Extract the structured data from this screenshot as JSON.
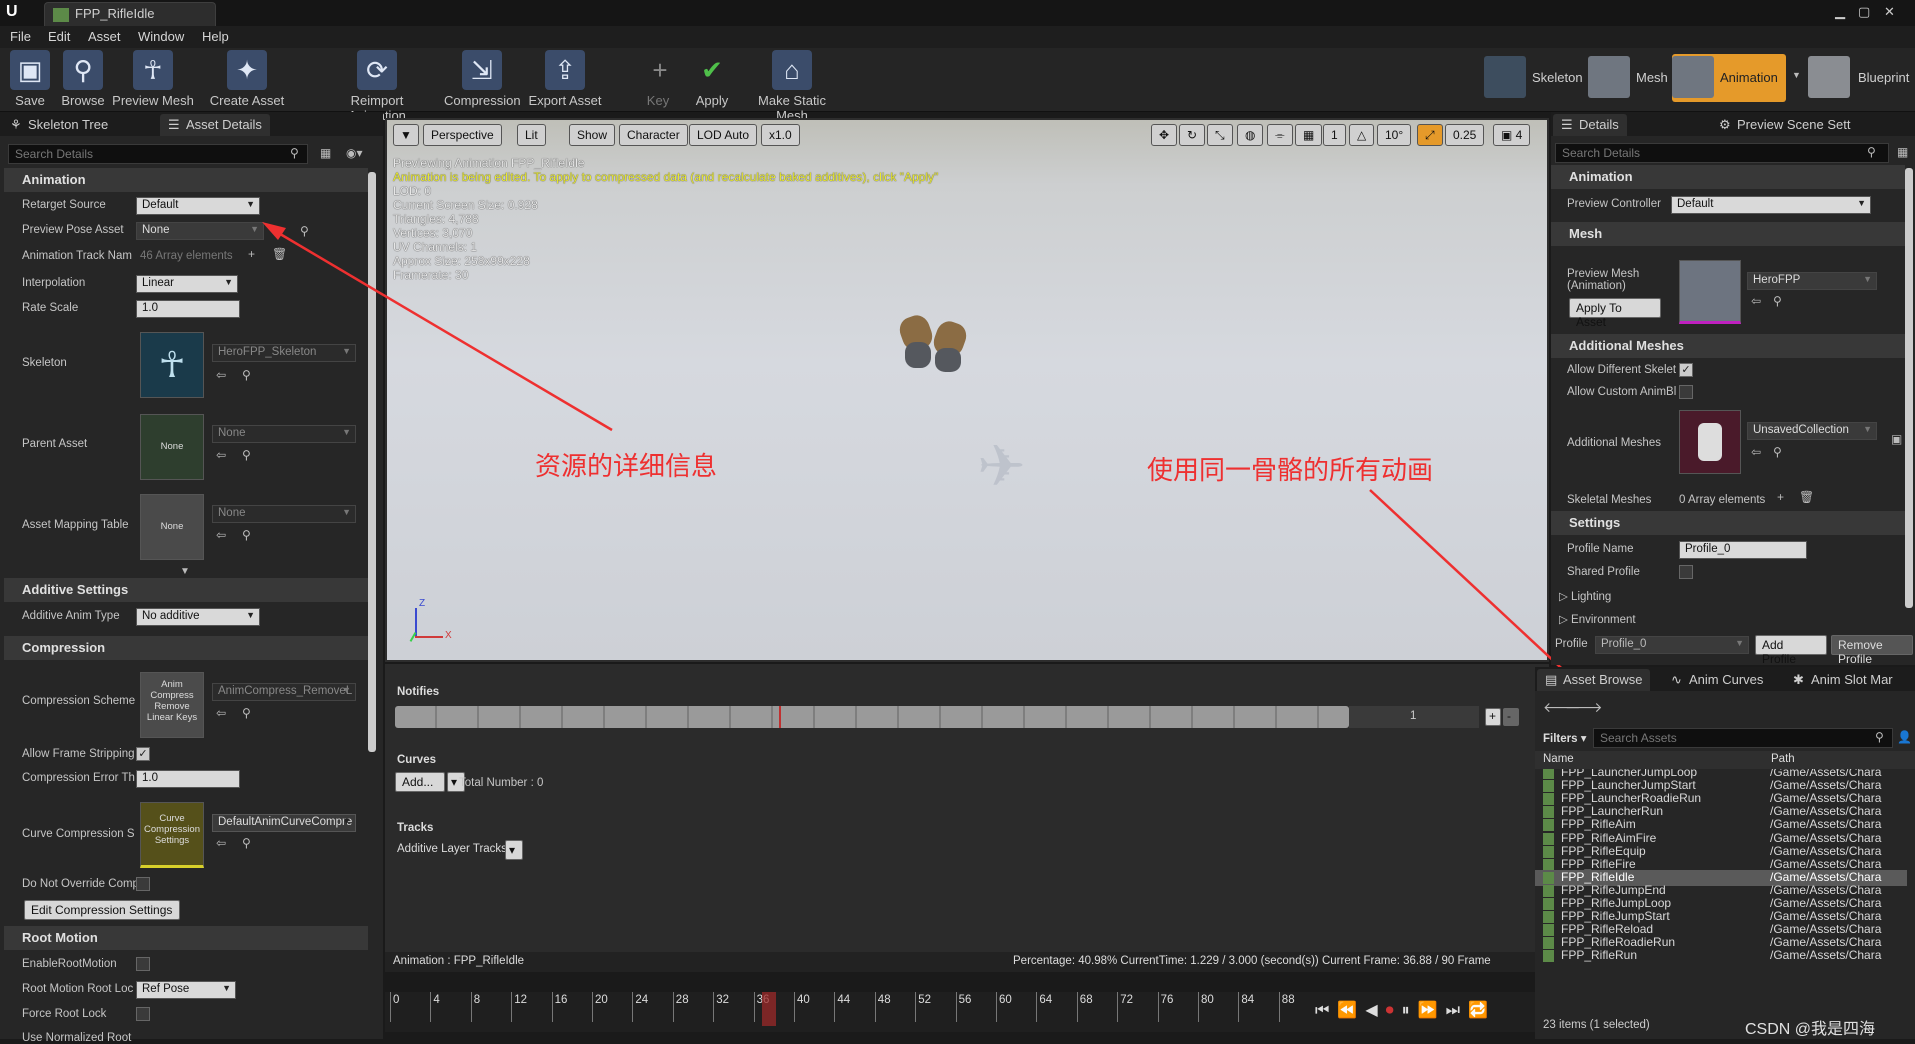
{
  "window": {
    "doc_tab": "FPP_RifleIdle"
  },
  "menu": [
    "File",
    "Edit",
    "Asset",
    "Window",
    "Help"
  ],
  "toolbar": {
    "save": "Save",
    "browse": "Browse",
    "preview_mesh": "Preview Mesh",
    "create_asset": "Create Asset",
    "reimport": "Reimport Animation",
    "compression": "Compression",
    "export": "Export Asset",
    "key": "Key",
    "apply": "Apply",
    "make_static": "Make Static Mesh",
    "modes": {
      "skeleton": "Skeleton",
      "mesh": "Mesh",
      "animation": "Animation",
      "blueprint": "Blueprint"
    }
  },
  "left_panel": {
    "tabs": [
      "Skeleton Tree",
      "Asset Details"
    ],
    "search_placeholder": "Search Details",
    "animation_cat": "Animation",
    "retarget_source_label": "Retarget Source",
    "retarget_source_value": "Default",
    "preview_pose_label": "Preview Pose Asset",
    "preview_pose_value": "None",
    "track_names_label": "Animation Track Nam",
    "track_names_value": "46 Array elements",
    "interpolation_label": "Interpolation",
    "interpolation_value": "Linear",
    "rate_scale_label": "Rate Scale",
    "rate_scale_value": "1.0",
    "skeleton_label": "Skeleton",
    "skeleton_value": "HeroFPP_Skeleton",
    "parent_asset_label": "Parent Asset",
    "parent_asset_thumb": "None",
    "parent_asset_value": "None",
    "mapping_label": "Asset Mapping Table",
    "mapping_thumb": "None",
    "mapping_value": "None",
    "additive_cat": "Additive Settings",
    "additive_type_label": "Additive Anim Type",
    "additive_type_value": "No additive",
    "compression_cat": "Compression",
    "compression_scheme_label": "Compression Scheme",
    "compression_scheme_thumb": "Anim Compress Remove Linear Keys",
    "compression_scheme_value": "AnimCompress_RemoveL",
    "allow_frame_label": "Allow Frame Stripping",
    "compression_error_label": "Compression Error Th",
    "compression_error_value": "1.0",
    "curve_compression_label": "Curve Compression S",
    "curve_compression_thumb": "Curve Compression Settings",
    "curve_compression_value": "DefaultAnimCurveCompre",
    "no_override_label": "Do Not Override Comp",
    "edit_compression_btn": "Edit Compression Settings",
    "root_motion_cat": "Root Motion",
    "enable_root_label": "EnableRootMotion",
    "root_lock_label": "Root Motion Root Loc",
    "root_lock_value": "Ref Pose",
    "force_root_label": "Force Root Lock",
    "use_normalized_label": "Use Normalized Root"
  },
  "viewport": {
    "buttons": {
      "perspective": "Perspective",
      "lit": "Lit",
      "show": "Show",
      "character": "Character",
      "lod": "LOD Auto",
      "speed": "x1.0"
    },
    "right_values": {
      "one": "1",
      "angle": "10°",
      "scale": "0.25",
      "cam": "4"
    },
    "overlay": [
      "Previewing Animation FPP_RifleIdle",
      "Animation is being edited. To apply to compressed data (and recalculate baked additives), click \"Apply\"",
      "LOD: 0",
      "Current Screen Size: 0.928",
      "Triangles: 4,788",
      "Vertices: 3,070",
      "UV Channels: 1",
      "Approx Size: 258x99x228",
      "Framerate: 30"
    ],
    "annotation_left": "资源的详细信息",
    "annotation_right": "使用同一骨骼的所有动画",
    "axis_z": "Z",
    "axis_x": "X"
  },
  "timeline": {
    "notifies": "Notifies",
    "notify_track_num": "1",
    "curves": "Curves",
    "add_btn": "Add...",
    "total": "Total Number : 0",
    "tracks": "Tracks",
    "additive_tracks": "Additive Layer Tracks",
    "status_left": "Animation :  FPP_RifleIdle",
    "status_right": "Percentage: 40.98% CurrentTime: 1.229 / 3.000 (second(s)) Current Frame: 36.88 / 90 Frame",
    "ticks": [
      "0",
      "4",
      "8",
      "12",
      "16",
      "20",
      "24",
      "28",
      "32",
      "36",
      "40",
      "44",
      "48",
      "52",
      "56",
      "60",
      "64",
      "68",
      "72",
      "76",
      "80",
      "84",
      "88"
    ],
    "progress": 0.4098
  },
  "right_panel": {
    "tabs": [
      "Details",
      "Preview Scene Sett"
    ],
    "search_placeholder": "Search Details",
    "animation_cat": "Animation",
    "preview_controller_label": "Preview Controller",
    "preview_controller_value": "Default",
    "mesh_cat": "Mesh",
    "preview_mesh_label": "Preview Mesh (Animation)",
    "preview_mesh_value": "HeroFPP",
    "apply_asset_btn": "Apply To Asset",
    "additional_cat": "Additional Meshes",
    "allow_diff_label": "Allow Different Skelet",
    "allow_custom_label": "Allow Custom AnimBl",
    "additional_meshes_label": "Additional Meshes",
    "additional_meshes_value": "UnsavedCollection",
    "skeletal_meshes_label": "Skeletal Meshes",
    "skeletal_meshes_value": "0 Array elements",
    "settings_cat": "Settings",
    "profile_name_label": "Profile Name",
    "profile_name_value": "Profile_0",
    "shared_profile_label": "Shared Profile",
    "lighting": "Lighting",
    "environment": "Environment",
    "profile_label": "Profile",
    "profile_value": "Profile_0",
    "add_profile_btn": "Add Profile",
    "remove_profile_btn": "Remove Profile"
  },
  "asset_browser": {
    "tabs": [
      "Asset Browse",
      "Anim Curves",
      "Anim Slot Mar"
    ],
    "filters": "Filters",
    "search_placeholder": "Search Assets",
    "col_name": "Name",
    "col_path": "Path",
    "rows": [
      {
        "name": "FPP_LauncherJumpLoop",
        "path": "/Game/Assets/Chara"
      },
      {
        "name": "FPP_LauncherJumpStart",
        "path": "/Game/Assets/Chara"
      },
      {
        "name": "FPP_LauncherRoadieRun",
        "path": "/Game/Assets/Chara"
      },
      {
        "name": "FPP_LauncherRun",
        "path": "/Game/Assets/Chara"
      },
      {
        "name": "FPP_RifleAim",
        "path": "/Game/Assets/Chara"
      },
      {
        "name": "FPP_RifleAimFire",
        "path": "/Game/Assets/Chara"
      },
      {
        "name": "FPP_RifleEquip",
        "path": "/Game/Assets/Chara"
      },
      {
        "name": "FPP_RifleFire",
        "path": "/Game/Assets/Chara"
      },
      {
        "name": "FPP_RifleIdle",
        "path": "/Game/Assets/Chara",
        "selected": true
      },
      {
        "name": "FPP_RifleJumpEnd",
        "path": "/Game/Assets/Chara"
      },
      {
        "name": "FPP_RifleJumpLoop",
        "path": "/Game/Assets/Chara"
      },
      {
        "name": "FPP_RifleJumpStart",
        "path": "/Game/Assets/Chara"
      },
      {
        "name": "FPP_RifleReload",
        "path": "/Game/Assets/Chara"
      },
      {
        "name": "FPP_RifleRoadieRun",
        "path": "/Game/Assets/Chara"
      },
      {
        "name": "FPP_RifleRun",
        "path": "/Game/Assets/Chara"
      }
    ],
    "items_count": "23 items (1 selected)",
    "watermark": "CSDN @我是四海"
  },
  "colors": {
    "accent_orange": "#e59a2a",
    "annotation_red": "#ee3030",
    "selection": "#5a5a5a"
  }
}
